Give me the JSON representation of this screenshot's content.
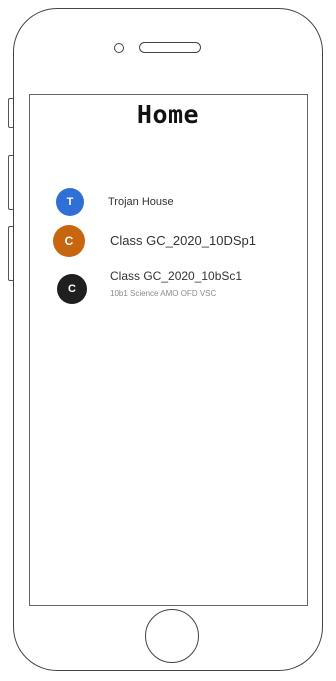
{
  "screen": {
    "title": "Home"
  },
  "items": [
    {
      "avatar_letter": "T",
      "avatar_color": "#2f6fd6",
      "title": "Trojan House",
      "subtitle": ""
    },
    {
      "avatar_letter": "C",
      "avatar_color": "#c8650f",
      "title": "Class GC_2020_10DSp1",
      "subtitle": ""
    },
    {
      "avatar_letter": "C",
      "avatar_color": "#1f1f1f",
      "title": "Class GC_2020_10bSc1",
      "subtitle": "10b1 Science AMO OFD VSC"
    }
  ]
}
